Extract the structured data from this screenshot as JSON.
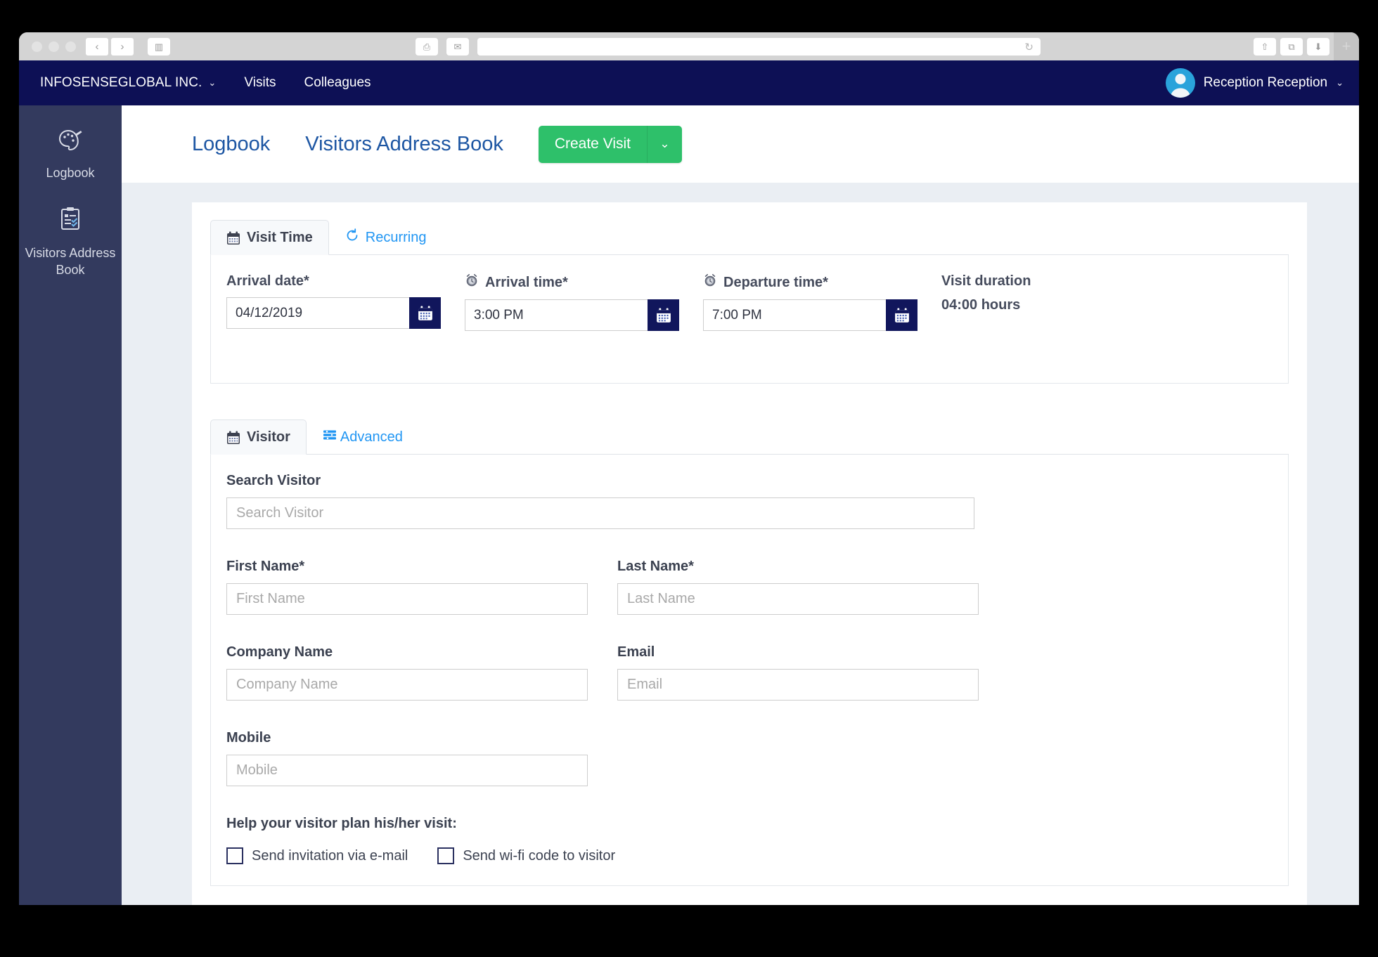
{
  "browser": {
    "window_dots": [
      "dot-1",
      "dot-2",
      "dot-3"
    ],
    "back_icon": "‹",
    "forward_icon": "›",
    "sidebar_icon": "▥",
    "print_icon": "⎙",
    "mail_icon": "✉",
    "home_icon": "⌂",
    "reload_icon": "↻",
    "share_icon": "⇧",
    "tabs_icon": "⧉",
    "downloads_icon": "⬇",
    "new_tab_icon": "+",
    "address_value": ""
  },
  "appbar": {
    "brand": "INFOSENSEGLOBAL INC.",
    "brand_caret": "⌄",
    "links": [
      {
        "label": "Visits"
      },
      {
        "label": "Colleagues"
      }
    ],
    "user_name": "Reception Reception",
    "user_caret": "⌄"
  },
  "sidebar": {
    "items": [
      {
        "label": "Logbook",
        "icon": "palette-icon"
      },
      {
        "label": "Visitors Address Book",
        "icon": "clipboard-icon"
      }
    ]
  },
  "page_header": {
    "links": [
      {
        "label": "Logbook"
      },
      {
        "label": "Visitors Address Book"
      }
    ],
    "create_visit_label": "Create Visit",
    "create_visit_caret": "⌄",
    "accent_green": "#2ec06a",
    "link_blue": "#1d56a3"
  },
  "visit_time": {
    "tabs": [
      {
        "label": "Visit Time",
        "icon": "calendar-icon",
        "active": true
      },
      {
        "label": "Recurring",
        "icon": "refresh-icon",
        "active": false
      }
    ],
    "arrival_date": {
      "label": "Arrival date*",
      "value": "04/12/2019",
      "button_icon": "calendar-icon"
    },
    "arrival_time": {
      "label": "Arrival time*",
      "icon": "alarm-clock-icon",
      "value": "3:00 PM",
      "button_icon": "calendar-icon"
    },
    "departure_time": {
      "label": "Departure time*",
      "icon": "alarm-clock-icon",
      "value": "7:00 PM",
      "button_icon": "calendar-icon"
    },
    "duration": {
      "label": "Visit duration",
      "value": "04:00 hours"
    }
  },
  "visitor": {
    "tabs": [
      {
        "label": "Visitor",
        "icon": "calendar-icon",
        "active": true
      },
      {
        "label": "Advanced",
        "icon": "sliders-icon",
        "active": false
      }
    ],
    "search": {
      "label": "Search Visitor",
      "placeholder": "Search Visitor",
      "value": ""
    },
    "first_name": {
      "label": "First Name*",
      "placeholder": "First Name",
      "value": ""
    },
    "last_name": {
      "label": "Last Name*",
      "placeholder": "Last Name",
      "value": ""
    },
    "company_name": {
      "label": "Company Name",
      "placeholder": "Company Name",
      "value": ""
    },
    "email": {
      "label": "Email",
      "placeholder": "Email",
      "value": ""
    },
    "mobile": {
      "label": "Mobile",
      "placeholder": "Mobile",
      "value": ""
    },
    "help_title": "Help your visitor plan his/her visit:",
    "checkboxes": [
      {
        "label": "Send invitation via e-mail",
        "checked": false
      },
      {
        "label": "Send wi-fi code to visitor",
        "checked": false
      }
    ]
  }
}
